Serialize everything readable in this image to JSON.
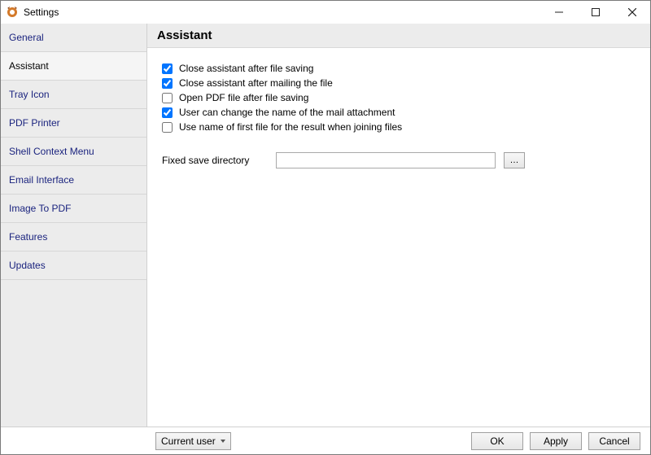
{
  "window": {
    "title": "Settings"
  },
  "sidebar": {
    "items": [
      {
        "label": "General",
        "selected": false
      },
      {
        "label": "Assistant",
        "selected": true
      },
      {
        "label": "Tray Icon",
        "selected": false
      },
      {
        "label": "PDF Printer",
        "selected": false
      },
      {
        "label": "Shell Context Menu",
        "selected": false
      },
      {
        "label": "Email Interface",
        "selected": false
      },
      {
        "label": "Image To PDF",
        "selected": false
      },
      {
        "label": "Features",
        "selected": false
      },
      {
        "label": "Updates",
        "selected": false
      }
    ]
  },
  "panel": {
    "title": "Assistant",
    "options": [
      {
        "label": "Close assistant after file saving",
        "checked": true
      },
      {
        "label": "Close assistant after mailing the file",
        "checked": true
      },
      {
        "label": "Open PDF file after file saving",
        "checked": false
      },
      {
        "label": "User can change the name of the mail attachment",
        "checked": true
      },
      {
        "label": "Use name of first file for the result when joining files",
        "checked": false
      }
    ],
    "fixed_dir_label": "Fixed save directory",
    "fixed_dir_value": "",
    "browse_label": "…"
  },
  "bottom": {
    "scope_selected": "Current user",
    "ok": "OK",
    "apply": "Apply",
    "cancel": "Cancel"
  }
}
